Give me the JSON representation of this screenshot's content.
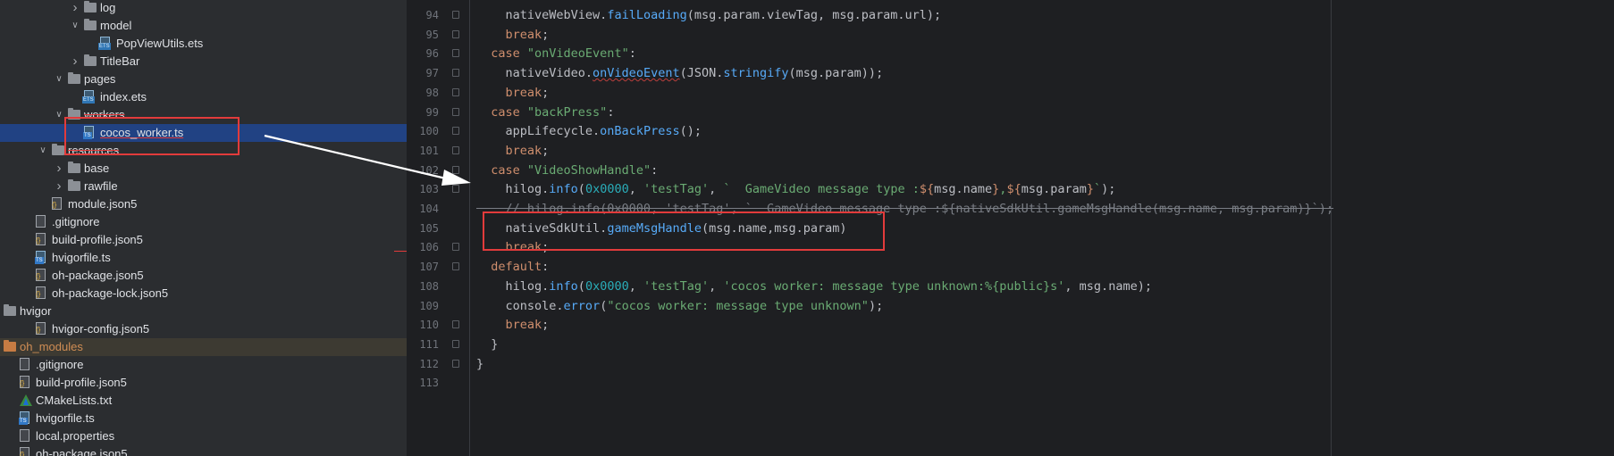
{
  "tree": {
    "items": [
      {
        "label": "log",
        "kind": "folder",
        "state": "collapsed"
      },
      {
        "label": "model",
        "kind": "folder",
        "state": "expanded"
      },
      {
        "label": "PopViewUtils.ets",
        "kind": "ets"
      },
      {
        "label": "TitleBar",
        "kind": "folder",
        "state": "collapsed"
      },
      {
        "label": "pages",
        "kind": "folder",
        "state": "expanded"
      },
      {
        "label": "index.ets",
        "kind": "ets"
      },
      {
        "label": "workers",
        "kind": "folder",
        "state": "expanded"
      },
      {
        "label": "cocos_worker.ts",
        "kind": "ts",
        "selected": true
      },
      {
        "label": "resources",
        "kind": "folder",
        "state": "expanded"
      },
      {
        "label": "base",
        "kind": "folder",
        "state": "collapsed"
      },
      {
        "label": "rawfile",
        "kind": "folder",
        "state": "collapsed"
      },
      {
        "label": "module.json5",
        "kind": "json"
      },
      {
        "label": ".gitignore",
        "kind": "plain"
      },
      {
        "label": "build-profile.json5",
        "kind": "json"
      },
      {
        "label": "hvigorfile.ts",
        "kind": "ts"
      },
      {
        "label": "oh-package.json5",
        "kind": "json"
      },
      {
        "label": "oh-package-lock.json5",
        "kind": "json"
      },
      {
        "label": "hvigor",
        "kind": "folder",
        "state": "expanded"
      },
      {
        "label": "hvigor-config.json5",
        "kind": "json"
      },
      {
        "label": "oh_modules",
        "kind": "folder-orange",
        "state": "collapsed",
        "excluded": true
      },
      {
        "label": ".gitignore",
        "kind": "plain"
      },
      {
        "label": "build-profile.json5",
        "kind": "json"
      },
      {
        "label": "CMakeLists.txt",
        "kind": "cmake"
      },
      {
        "label": "hvigorfile.ts",
        "kind": "ts"
      },
      {
        "label": "local.properties",
        "kind": "props"
      },
      {
        "label": "oh-package.json5",
        "kind": "json"
      }
    ]
  },
  "editor": {
    "lines": [
      {
        "n": "94",
        "segs": [
          [
            "plain",
            "    nativeWebView."
          ],
          [
            "fn",
            "failLoading"
          ],
          [
            "plain",
            "(msg.param.viewTag, msg.param.url);"
          ]
        ]
      },
      {
        "n": "95",
        "segs": [
          [
            "kw",
            "    break"
          ],
          [
            "plain",
            ";"
          ]
        ]
      },
      {
        "n": "96",
        "segs": [
          [
            "kw",
            "  case "
          ],
          [
            "str",
            "\"onVideoEvent\""
          ],
          [
            "plain",
            ":"
          ]
        ]
      },
      {
        "n": "97",
        "segs": [
          [
            "plain",
            "    nativeVideo."
          ],
          [
            "fnsq",
            "onVideoEvent"
          ],
          [
            "plain",
            "(JSON."
          ],
          [
            "fn",
            "stringify"
          ],
          [
            "plain",
            "(msg.param));"
          ]
        ]
      },
      {
        "n": "98",
        "segs": [
          [
            "kw",
            "    break"
          ],
          [
            "plain",
            ";"
          ]
        ]
      },
      {
        "n": "99",
        "segs": [
          [
            "kw",
            "  case "
          ],
          [
            "str",
            "\"backPress\""
          ],
          [
            "plain",
            ":"
          ]
        ]
      },
      {
        "n": "100",
        "segs": [
          [
            "plain",
            "    appLifecycle."
          ],
          [
            "fn",
            "onBackPress"
          ],
          [
            "plain",
            "();"
          ]
        ]
      },
      {
        "n": "101",
        "segs": [
          [
            "kw",
            "    break"
          ],
          [
            "plain",
            ";"
          ]
        ]
      },
      {
        "n": "102",
        "segs": [
          [
            "kw",
            "  case "
          ],
          [
            "str",
            "\"VideoShowHandle\""
          ],
          [
            "plain",
            ":"
          ]
        ]
      },
      {
        "n": "103",
        "segs": [
          [
            "plain",
            "    hilog."
          ],
          [
            "fn",
            "info"
          ],
          [
            "plain",
            "("
          ],
          [
            "num",
            "0x0000"
          ],
          [
            "plain",
            ", "
          ],
          [
            "str",
            "'testTag'"
          ],
          [
            "plain",
            ", "
          ],
          [
            "str",
            "`  GameVideo message type :"
          ],
          [
            "kw",
            "${"
          ],
          [
            "plain",
            "msg.name"
          ],
          [
            "kw",
            "}"
          ],
          [
            "str",
            ","
          ],
          [
            "kw",
            "${"
          ],
          [
            "plain",
            "msg.param"
          ],
          [
            "kw",
            "}"
          ],
          [
            "str",
            "`"
          ],
          [
            "plain",
            ");"
          ]
        ]
      },
      {
        "n": "104",
        "segs": [
          [
            "cmst",
            "    // hilog.info(0x0000, 'testTag', `  GameVideo message type :${nativeSdkUtil.gameMsgHandle(msg.name, msg.param)}`);"
          ]
        ]
      },
      {
        "n": "105",
        "segs": [
          [
            "plain",
            "    nativeSdkUtil."
          ],
          [
            "fn",
            "gameMsgHandle"
          ],
          [
            "plain",
            "(msg.name,msg.param)"
          ]
        ]
      },
      {
        "n": "106",
        "segs": [
          [
            "kw",
            "    break"
          ],
          [
            "plain",
            ";"
          ]
        ]
      },
      {
        "n": "107",
        "segs": [
          [
            "kw",
            "  default"
          ],
          [
            "plain",
            ":"
          ]
        ]
      },
      {
        "n": "108",
        "segs": [
          [
            "plain",
            "    hilog."
          ],
          [
            "fn",
            "info"
          ],
          [
            "plain",
            "("
          ],
          [
            "num",
            "0x0000"
          ],
          [
            "plain",
            ", "
          ],
          [
            "str",
            "'testTag'"
          ],
          [
            "plain",
            ", "
          ],
          [
            "str",
            "'cocos worker: message type unknown:%{public}s'"
          ],
          [
            "plain",
            ", msg.name);"
          ]
        ]
      },
      {
        "n": "109",
        "segs": [
          [
            "plain",
            "    console."
          ],
          [
            "fn",
            "error"
          ],
          [
            "plain",
            "("
          ],
          [
            "str",
            "\"cocos worker: message type unknown\""
          ],
          [
            "plain",
            ");"
          ]
        ]
      },
      {
        "n": "110",
        "segs": [
          [
            "kw",
            "    break"
          ],
          [
            "plain",
            ";"
          ]
        ]
      },
      {
        "n": "111",
        "segs": [
          [
            "plain",
            "  }"
          ]
        ]
      },
      {
        "n": "112",
        "segs": [
          [
            "plain",
            "}"
          ]
        ]
      },
      {
        "n": "113",
        "segs": []
      }
    ]
  },
  "colors": {
    "annotation_red": "#e23b3b",
    "arrow_white": "#ffffff",
    "selection_blue": "#214283"
  }
}
